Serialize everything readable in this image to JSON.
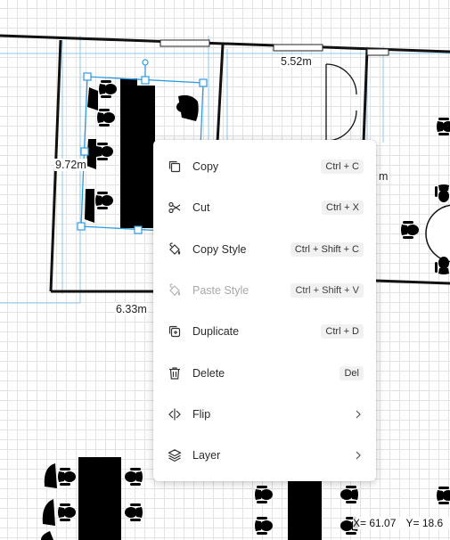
{
  "canvas": {
    "dimensions": [
      "5.52m",
      "9.72m",
      "6.33m",
      "m"
    ]
  },
  "status": {
    "x_readout": "X= 61.07",
    "y_readout": "Y= 18.6"
  },
  "context_menu": {
    "items": [
      {
        "label": "Copy",
        "shortcut": "Ctrl + C",
        "icon": "copy-icon"
      },
      {
        "label": "Cut",
        "shortcut": "Ctrl + X",
        "icon": "scissors-icon"
      },
      {
        "label": "Copy Style",
        "shortcut": "Ctrl + Shift + C",
        "icon": "paint-bucket-icon"
      },
      {
        "label": "Paste Style",
        "shortcut": "Ctrl + Shift + V",
        "icon": "paint-bucket-icon",
        "disabled": true
      },
      {
        "label": "Duplicate",
        "shortcut": "Ctrl + D",
        "icon": "duplicate-icon"
      },
      {
        "label": "Delete",
        "shortcut": "Del",
        "icon": "trash-icon"
      },
      {
        "label": "Flip",
        "icon": "flip-icon",
        "submenu": true
      },
      {
        "label": "Layer",
        "icon": "layers-icon",
        "submenu": true
      }
    ]
  },
  "colors": {
    "selection": "#2d9be0",
    "wall": "#111111",
    "guide": "#8fcaee"
  }
}
